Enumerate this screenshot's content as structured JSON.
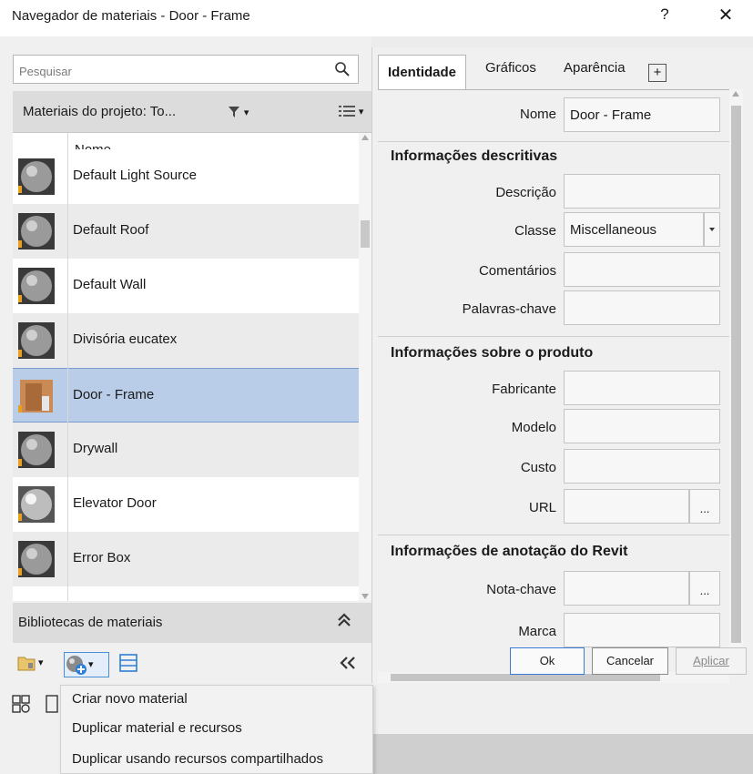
{
  "window": {
    "title": "Navegador de materiais - Door - Frame",
    "help_label": "?",
    "close_label": "✕"
  },
  "search": {
    "placeholder": "Pesquisar"
  },
  "project": {
    "label": "Materiais do projeto: To...",
    "filter_arrow": "▾",
    "view_arrow": "▾"
  },
  "materials": {
    "column_header": "Nome",
    "rows": [
      {
        "name": "Default Light Source",
        "icon": "sphere-gray"
      },
      {
        "name": "Default Roof",
        "icon": "sphere-gray"
      },
      {
        "name": "Default Wall",
        "icon": "sphere-gray"
      },
      {
        "name": "Divisória eucatex",
        "icon": "sphere-gray"
      },
      {
        "name": "Door - Frame",
        "icon": "wood-door",
        "selected": true
      },
      {
        "name": "Drywall",
        "icon": "sphere-gray"
      },
      {
        "name": "Elevator Door",
        "icon": "sphere-metal"
      },
      {
        "name": "Error Box",
        "icon": "sphere-gray"
      }
    ]
  },
  "libraries": {
    "label": "Bibliotecas de materiais"
  },
  "tabs": {
    "identity": "Identidade",
    "graphics": "Gráficos",
    "appearance": "Aparência",
    "add": "+"
  },
  "identity": {
    "name_label": "Nome",
    "name_value": "Door - Frame",
    "section_descriptive": "Informações descritivas",
    "description_label": "Descrição",
    "description_value": "",
    "class_label": "Classe",
    "class_value": "Miscellaneous",
    "comments_label": "Comentários",
    "comments_value": "",
    "keywords_label": "Palavras-chave",
    "keywords_value": "",
    "section_product": "Informações sobre o produto",
    "manufacturer_label": "Fabricante",
    "model_label": "Modelo",
    "cost_label": "Custo",
    "url_label": "URL",
    "dots_label": "...",
    "section_revit": "Informações de anotação do Revit",
    "keynote_label": "Nota-chave",
    "mark_label": "Marca"
  },
  "menu": {
    "items": [
      "Criar novo material",
      "Duplicar material e recursos",
      "Duplicar usando recursos compartilhados"
    ]
  },
  "buttons": {
    "ok": "Ok",
    "cancel": "Cancelar",
    "apply": "Aplicar"
  },
  "colors": {
    "selection": "#b9cde8",
    "accent": "#3b7bd4"
  }
}
